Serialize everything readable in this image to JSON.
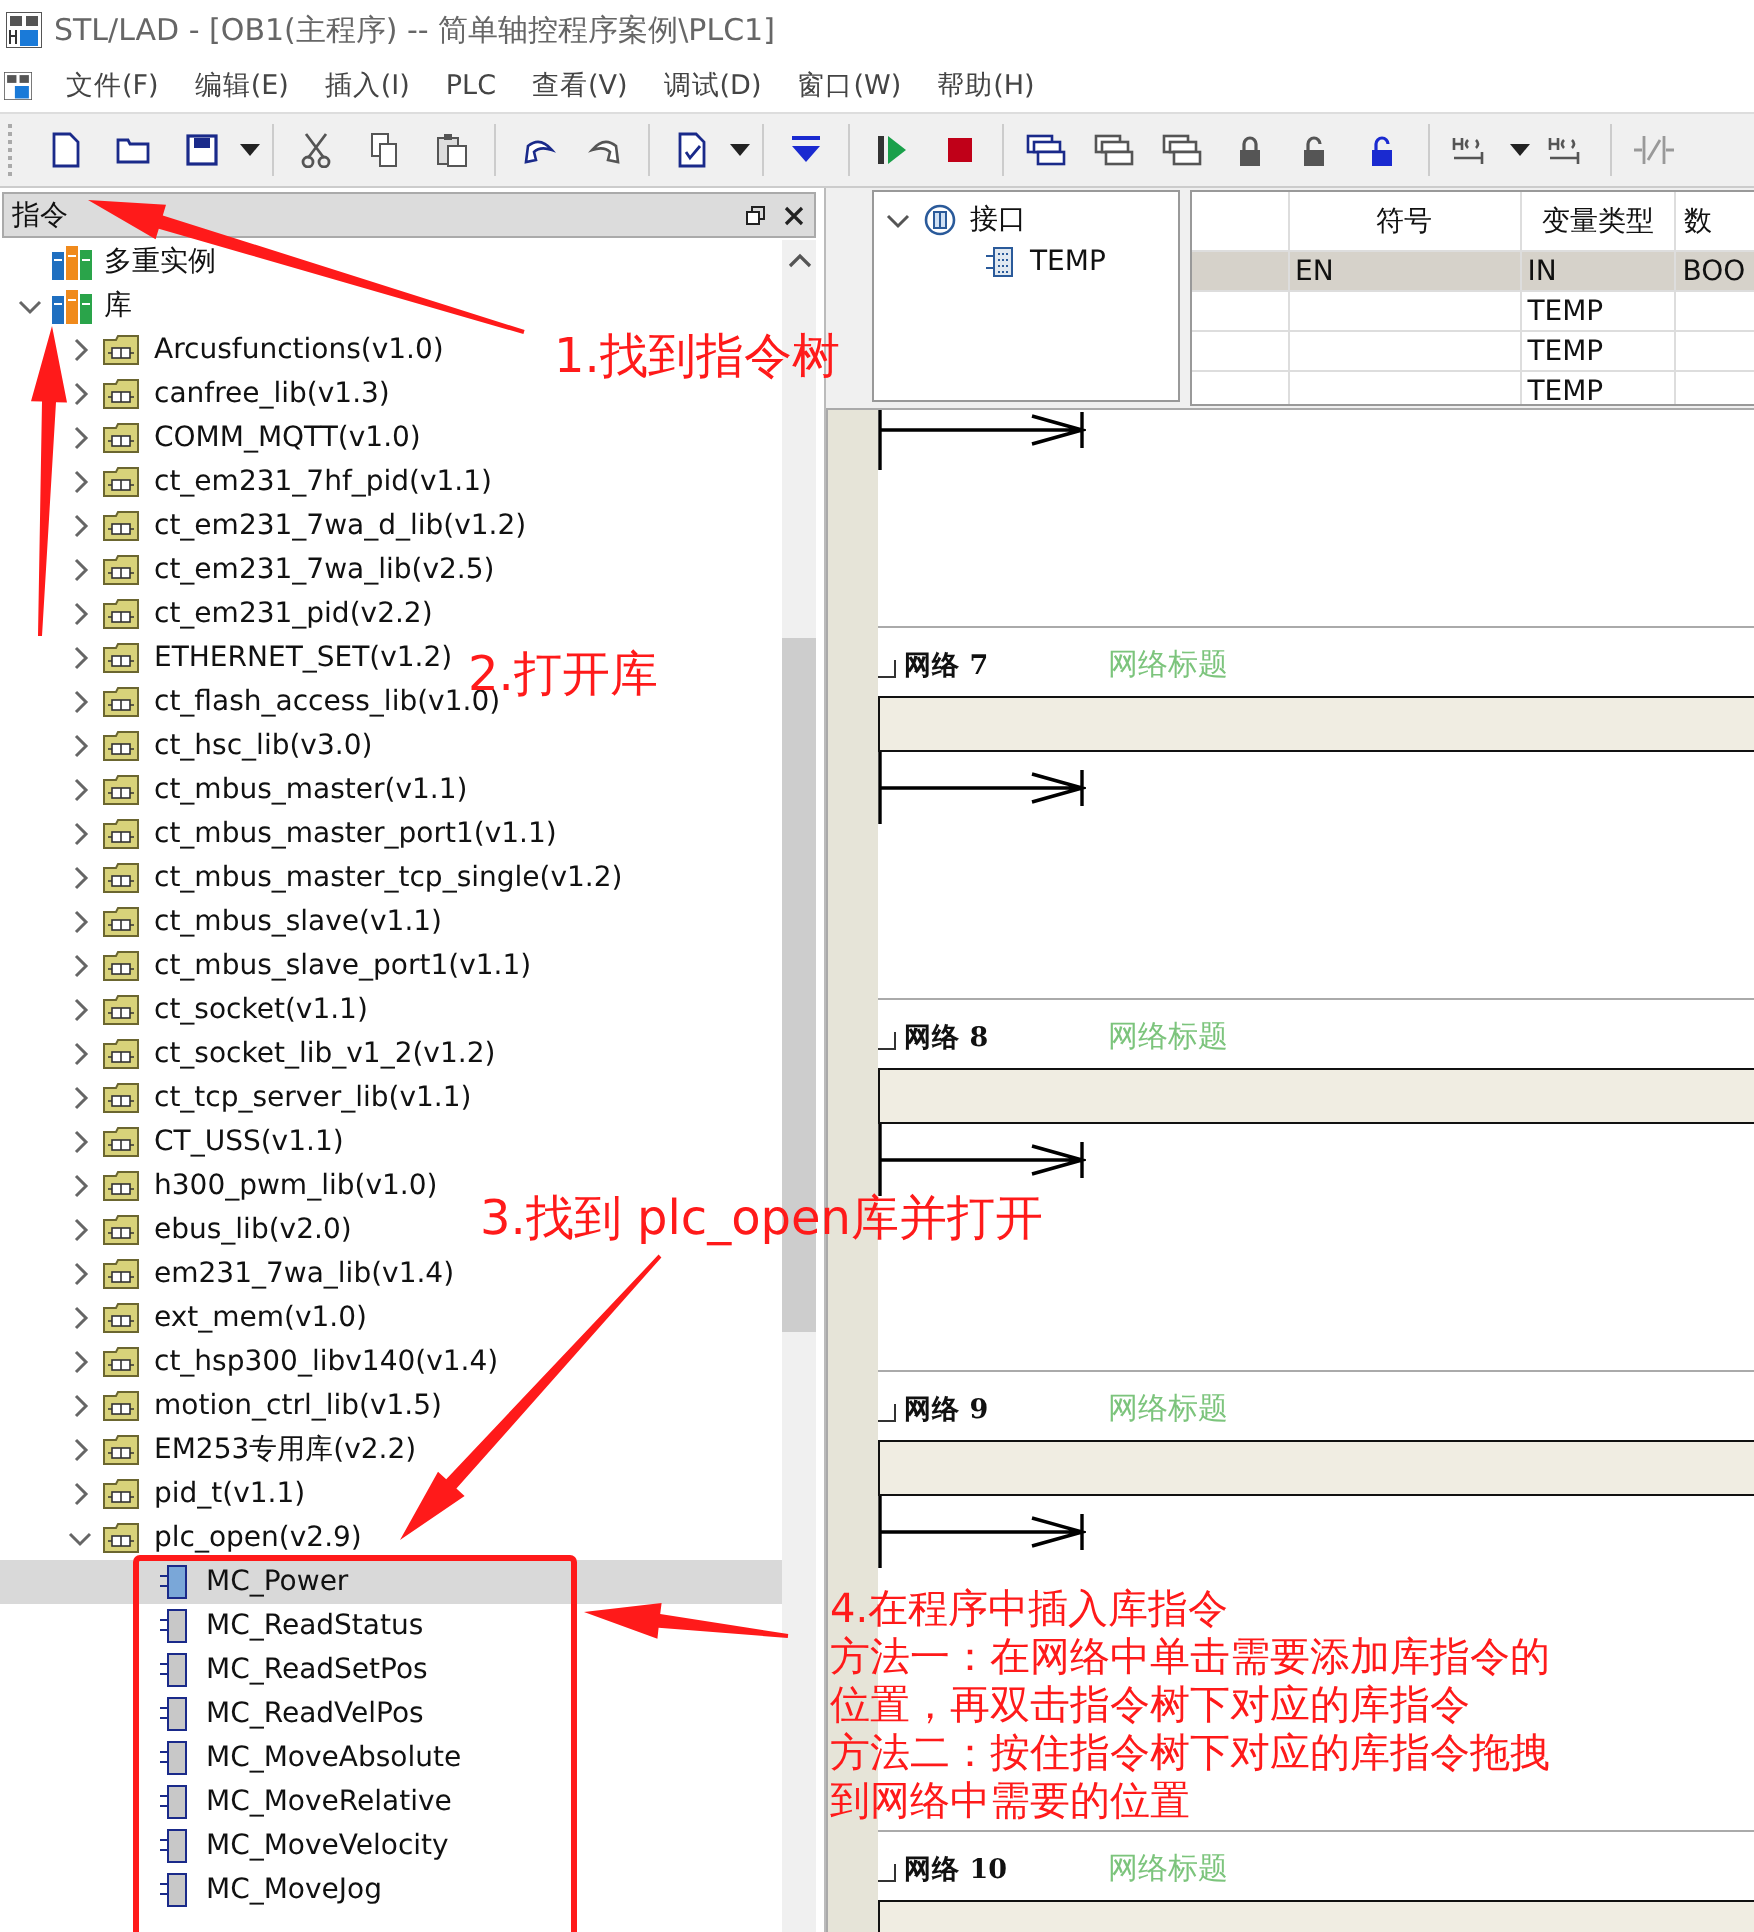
{
  "window": {
    "title": "STL/LAD - [OB1(主程序) -- 简单轴控程序案例\\PLC1]"
  },
  "menu": [
    "文件(F)",
    "编辑(E)",
    "插入(I)",
    "PLC",
    "查看(V)",
    "调试(D)",
    "窗口(W)",
    "帮助(H)"
  ],
  "instruction_panel": {
    "title": "指令",
    "tree": [
      {
        "label": "多重实例",
        "kind": "group"
      },
      {
        "label": "库",
        "kind": "group",
        "expanded": true,
        "children": [
          {
            "label": "Arcusfunctions(v1.0)",
            "kind": "library",
            "expanded": false
          },
          {
            "label": "canfree_lib(v1.3)",
            "kind": "library",
            "expanded": false
          },
          {
            "label": "COMM_MQTT(v1.0)",
            "kind": "library",
            "expanded": false
          },
          {
            "label": "ct_em231_7hf_pid(v1.1)",
            "kind": "library",
            "expanded": false
          },
          {
            "label": "ct_em231_7wa_d_lib(v1.2)",
            "kind": "library",
            "expanded": false
          },
          {
            "label": "ct_em231_7wa_lib(v2.5)",
            "kind": "library",
            "expanded": false
          },
          {
            "label": "ct_em231_pid(v2.2)",
            "kind": "library",
            "expanded": false
          },
          {
            "label": "ETHERNET_SET(v1.2)",
            "kind": "library",
            "expanded": false
          },
          {
            "label": "ct_flash_access_lib(v1.0)",
            "kind": "library",
            "expanded": false
          },
          {
            "label": "ct_hsc_lib(v3.0)",
            "kind": "library",
            "expanded": false
          },
          {
            "label": "ct_mbus_master(v1.1)",
            "kind": "library",
            "expanded": false
          },
          {
            "label": "ct_mbus_master_port1(v1.1)",
            "kind": "library",
            "expanded": false
          },
          {
            "label": "ct_mbus_master_tcp_single(v1.2)",
            "kind": "library",
            "expanded": false
          },
          {
            "label": "ct_mbus_slave(v1.1)",
            "kind": "library",
            "expanded": false
          },
          {
            "label": "ct_mbus_slave_port1(v1.1)",
            "kind": "library",
            "expanded": false
          },
          {
            "label": "ct_socket(v1.1)",
            "kind": "library",
            "expanded": false
          },
          {
            "label": "ct_socket_lib_v1_2(v1.2)",
            "kind": "library",
            "expanded": false
          },
          {
            "label": "ct_tcp_server_lib(v1.1)",
            "kind": "library",
            "expanded": false
          },
          {
            "label": "CT_USS(v1.1)",
            "kind": "library",
            "expanded": false
          },
          {
            "label": "h300_pwm_lib(v1.0)",
            "kind": "library",
            "expanded": false
          },
          {
            "label": "ebus_lib(v2.0)",
            "kind": "library",
            "expanded": false
          },
          {
            "label": "em231_7wa_lib(v1.4)",
            "kind": "library",
            "expanded": false
          },
          {
            "label": "ext_mem(v1.0)",
            "kind": "library",
            "expanded": false
          },
          {
            "label": "ct_hsp300_libv140(v1.4)",
            "kind": "library",
            "expanded": false
          },
          {
            "label": "motion_ctrl_lib(v1.5)",
            "kind": "library",
            "expanded": false
          },
          {
            "label": "EM253专用库(v2.2)",
            "kind": "library",
            "expanded": false
          },
          {
            "label": "pid_t(v1.1)",
            "kind": "library",
            "expanded": false
          },
          {
            "label": "plc_open(v2.9)",
            "kind": "library",
            "expanded": true,
            "children": [
              {
                "label": "MC_Power",
                "kind": "instruction",
                "selected": true
              },
              {
                "label": "MC_ReadStatus",
                "kind": "instruction",
                "selected": false
              },
              {
                "label": "MC_ReadSetPos",
                "kind": "instruction",
                "selected": false
              },
              {
                "label": "MC_ReadVelPos",
                "kind": "instruction",
                "selected": false
              },
              {
                "label": "MC_MoveAbsolute",
                "kind": "instruction",
                "selected": false
              },
              {
                "label": "MC_MoveRelative",
                "kind": "instruction",
                "selected": false
              },
              {
                "label": "MC_MoveVelocity",
                "kind": "instruction",
                "selected": false
              },
              {
                "label": "MC_MoveJog",
                "kind": "instruction",
                "selected": false
              }
            ]
          }
        ]
      }
    ]
  },
  "interface": {
    "tree": {
      "label": "接口",
      "expanded": true,
      "children": [
        {
          "label": "TEMP"
        }
      ]
    },
    "table": {
      "columns": [
        "符号",
        "变量类型",
        "数"
      ],
      "rows": [
        {
          "symbol": "EN",
          "var_type": "IN",
          "data_type": "BOO",
          "selected": true
        },
        {
          "var_type": "TEMP",
          "selected": false
        },
        {
          "var_type": "TEMP",
          "selected": false
        },
        {
          "var_type": "TEMP",
          "selected": false
        }
      ]
    }
  },
  "networks": [
    {
      "label": "网络 7",
      "title": "网络标题"
    },
    {
      "label": "网络 8",
      "title": "网络标题"
    },
    {
      "label": "网络 9",
      "title": "网络标题"
    },
    {
      "label": "网络 10",
      "title": "网络标题"
    }
  ],
  "annotations": [
    {
      "lines": [
        "1.找到指令树"
      ]
    },
    {
      "lines": [
        "2.打开库"
      ]
    },
    {
      "lines": [
        "3.找到 plc_open库并打开"
      ]
    },
    {
      "lines": [
        "4.在程序中插入库指令",
        "方法一：在网络中单击需要添加库指令的",
        "位置，再双击指令树下对应的库指令",
        "方法二：按住指令树下对应的库指令拖拽",
        "到网络中需要的位置"
      ]
    }
  ]
}
